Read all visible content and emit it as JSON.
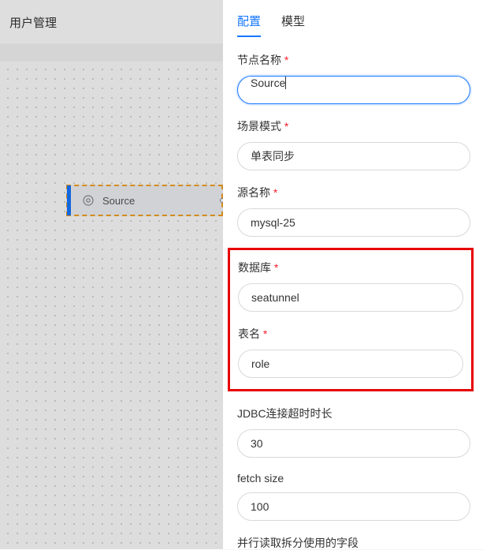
{
  "header": {
    "title": "用户管理"
  },
  "canvas": {
    "node": {
      "label": "Source"
    }
  },
  "panel": {
    "tabs": {
      "config": "配置",
      "model": "模型"
    },
    "fields": {
      "node_name": {
        "label": "节点名称",
        "value": "Source"
      },
      "scene_mode": {
        "label": "场景模式",
        "value": "单表同步"
      },
      "source_name": {
        "label": "源名称",
        "value": "mysql-25"
      },
      "database": {
        "label": "数据库",
        "value": "seatunnel"
      },
      "table_name": {
        "label": "表名",
        "value": "role"
      },
      "jdbc_timeout": {
        "label": "JDBC连接超时时长",
        "value": "30"
      },
      "fetch_size": {
        "label": "fetch size",
        "value": "100"
      },
      "parallel_split": {
        "label": "并行读取拆分使用的字段"
      }
    }
  }
}
